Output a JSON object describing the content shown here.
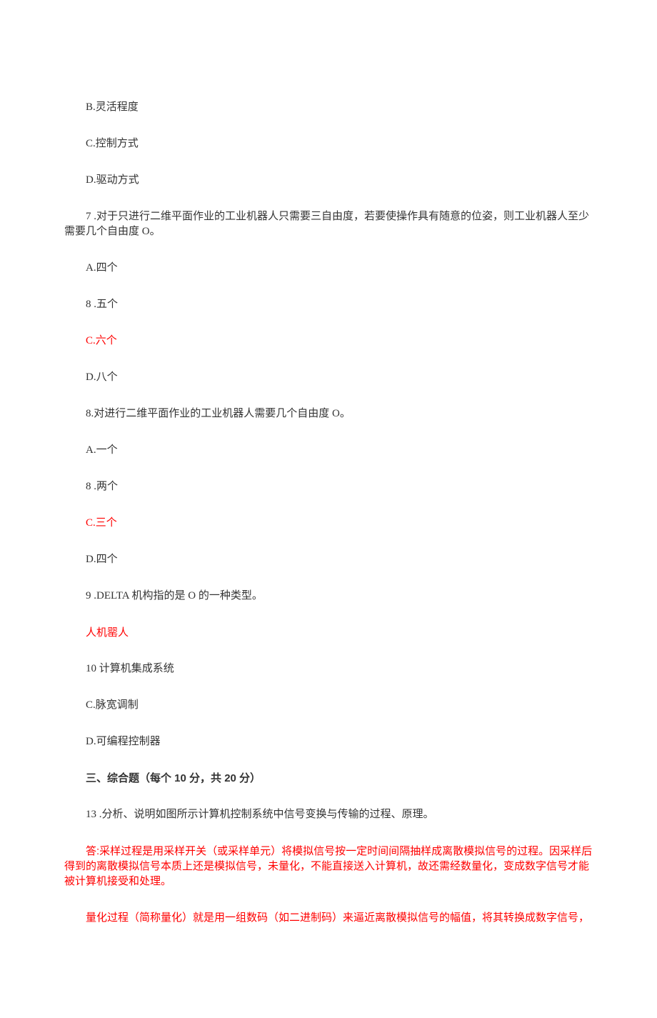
{
  "lines": [
    {
      "text": "B.灵活程度",
      "red": false,
      "bold": false,
      "sans": false,
      "noindent": false
    },
    {
      "text": "C.控制方式",
      "red": false,
      "bold": false,
      "sans": false,
      "noindent": false
    },
    {
      "text": "D.驱动方式",
      "red": false,
      "bold": false,
      "sans": false,
      "noindent": false
    },
    {
      "text": "7 .对于只进行二维平面作业的工业机器人只需要三自由度，若要使操作具有随意的位姿，则工业机器人至少需要几个自由度 O。",
      "red": false,
      "bold": false,
      "sans": false,
      "noindent": false
    },
    {
      "text": "A.四个",
      "red": false,
      "bold": false,
      "sans": false,
      "noindent": false
    },
    {
      "text": "8   .五个",
      "red": false,
      "bold": false,
      "sans": false,
      "noindent": false
    },
    {
      "text": "C.六个",
      "red": true,
      "bold": false,
      "sans": false,
      "noindent": false
    },
    {
      "text": "D.八个",
      "red": false,
      "bold": false,
      "sans": false,
      "noindent": false
    },
    {
      "text": "8.对进行二维平面作业的工业机器人需要几个自由度 O。",
      "red": false,
      "bold": false,
      "sans": false,
      "noindent": false
    },
    {
      "text": "A.一个",
      "red": false,
      "bold": false,
      "sans": false,
      "noindent": false
    },
    {
      "text": "8 .两个",
      "red": false,
      "bold": false,
      "sans": false,
      "noindent": false
    },
    {
      "text": "C.三个",
      "red": true,
      "bold": false,
      "sans": false,
      "noindent": false
    },
    {
      "text": "D.四个",
      "red": false,
      "bold": false,
      "sans": false,
      "noindent": false
    },
    {
      "text": "9 .DELTA 机构指的是 O 的一种类型。",
      "red": false,
      "bold": false,
      "sans": false,
      "noindent": false
    },
    {
      "text": "人机罂人",
      "red": true,
      "bold": false,
      "sans": true,
      "noindent": false
    },
    {
      "text": "10 计算机集成系统",
      "red": false,
      "bold": false,
      "sans": false,
      "noindent": false
    },
    {
      "text": "C.脉宽调制",
      "red": false,
      "bold": false,
      "sans": false,
      "noindent": false
    },
    {
      "text": "D.可编程控制器",
      "red": false,
      "bold": false,
      "sans": false,
      "noindent": false
    },
    {
      "text": "三、综合题（每个 10 分，共 20 分）",
      "red": false,
      "bold": true,
      "sans": true,
      "noindent": false
    },
    {
      "text": "13 .分析、说明如图所示计算机控制系统中信号变换与传输的过程、原理。",
      "red": false,
      "bold": false,
      "sans": false,
      "noindent": false
    },
    {
      "text": "答:采样过程是用采样开关（或采样单元）将模拟信号按一定时间间隔抽样成离散模拟信号的过程。因采样后得到的离散模拟信号本质上还是模拟信号，未量化，不能直接送入计算机，故还需经数量化，变成数字信号才能被计算机接受和处理。",
      "red": true,
      "bold": false,
      "sans": true,
      "noindent": false
    },
    {
      "text": "量化过程（简称量化）就是用一组数码（如二进制码）来逼近离散模拟信号的幅值，将其转换成数字信号，",
      "red": true,
      "bold": false,
      "sans": true,
      "noindent": false
    }
  ]
}
